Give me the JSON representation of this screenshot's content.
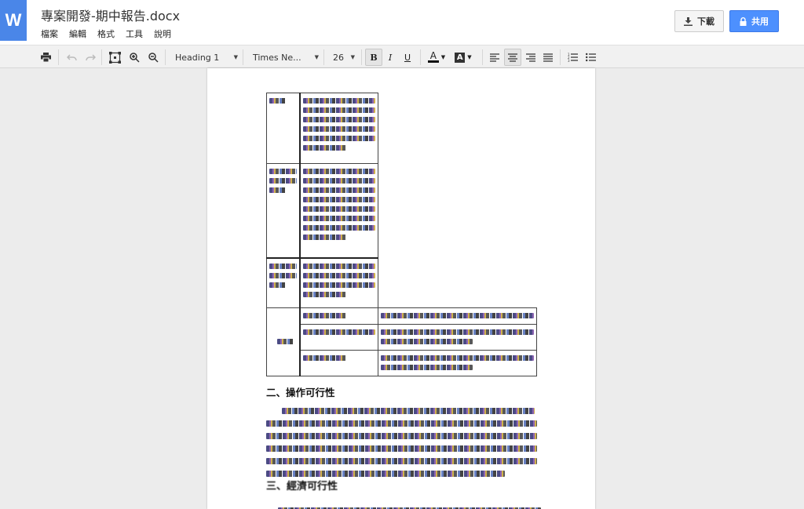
{
  "app": {
    "logo_letter": "W",
    "doc_title": "專案開發-期中報告.docx"
  },
  "menu": [
    "檔案",
    "編輯",
    "格式",
    "工具",
    "說明"
  ],
  "actions": {
    "download_label": "下載",
    "share_label": "共用"
  },
  "toolbar": {
    "style_select": "Heading 1",
    "font_select": "Times Ne...",
    "size_select": "26",
    "bold": "B",
    "italic": "I",
    "underline": "U",
    "text_color": "A",
    "highlight": "A"
  },
  "document": {
    "section2_heading": "二、操作可行性",
    "section3_heading": "三、經濟可行性"
  },
  "colors": {
    "accent": "#4a86e8",
    "share": "#4d90fe"
  }
}
